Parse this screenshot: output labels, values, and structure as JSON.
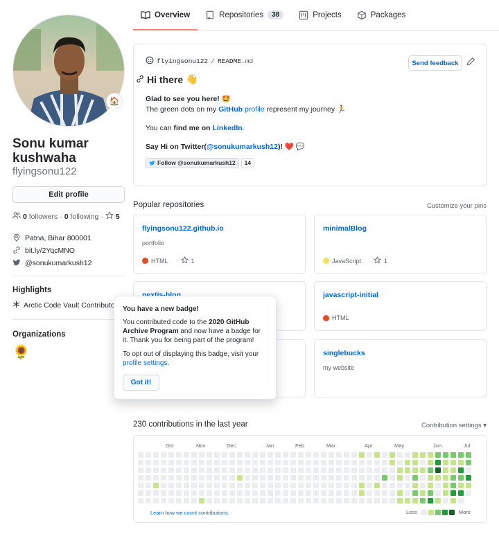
{
  "tabs": [
    {
      "label": "Overview",
      "icon": "book-icon",
      "active": true
    },
    {
      "label": "Repositories",
      "icon": "repo-icon",
      "count": "38"
    },
    {
      "label": "Projects",
      "icon": "project-icon"
    },
    {
      "label": "Packages",
      "icon": "package-icon"
    }
  ],
  "profile": {
    "fullname": "Sonu kumar kushwaha",
    "username": "flyingsonu122",
    "status_emoji": "🏠",
    "edit_label": "Edit profile",
    "followers": "0",
    "followers_label": "followers",
    "following": "0",
    "following_label": "following",
    "stars": "5",
    "location": "Patna, Bihar 800001",
    "website": "bit.ly/2YqcMNO",
    "twitter": "@sonukumarkush12"
  },
  "highlights": {
    "title": "Highlights",
    "item": "Arctic Code Vault Contributor"
  },
  "organizations": {
    "title": "Organizations",
    "icon": "🌻"
  },
  "readme": {
    "owner": "flyingsonu122",
    "separator": "/",
    "file_base": "README",
    "file_ext": ".md",
    "feedback_label": "Send feedback",
    "heading": "Hi there",
    "heading_emoji": "👋",
    "line1": "Glad to see you here! 🤩",
    "line2_a": "The green dots on my ",
    "line2_b": "GitHub",
    "line2_c": " profile",
    "line2_d": " represent my journey 🏃",
    "line3_a": "You can ",
    "line3_b": "find me on",
    "line3_c": " LinkedIn",
    "line3_d": ".",
    "line4_a": "Say Hi on Twitter(",
    "line4_b": "@sonukumarkush12",
    "line4_c": ")! ❤️ 💬",
    "badge_label": "Follow @sonukumarkush12",
    "badge_count": "14"
  },
  "pinned": {
    "title": "Popular repositories",
    "customize": "Customize your pins",
    "repos": [
      {
        "name": "flyingsonu122.github.io",
        "desc": "portfolio",
        "lang": "HTML",
        "lang_color": "#e34c26",
        "stars": "1"
      },
      {
        "name": "minimalBlog",
        "desc": "",
        "lang": "JavaScript",
        "lang_color": "#f1e05a",
        "stars": "1"
      },
      {
        "name": "nextjs-blog",
        "desc": "",
        "lang": "",
        "lang_color": "",
        "stars": ""
      },
      {
        "name": "javascript-initial",
        "desc": "",
        "lang": "HTML",
        "lang_color": "#e34c26",
        "stars": ""
      },
      {
        "name": "",
        "desc": "",
        "lang": "",
        "lang_color": "",
        "stars": ""
      },
      {
        "name": "singlebucks",
        "desc": "my website",
        "lang": "",
        "lang_color": "",
        "stars": ""
      }
    ]
  },
  "popover": {
    "title": "You have a new badge!",
    "text_a": "You contributed code to the ",
    "text_b": "2020 GitHub Archive Program",
    "text_c": " and now have a badge for it. Thank you for being part of the program!",
    "opt_a": "To opt out of displaying this badge, visit your ",
    "opt_b": "profile settings",
    "opt_c": ".",
    "button": "Got it!"
  },
  "contributions": {
    "title": "230 contributions in the last year",
    "settings": "Contribution settings ▾",
    "months": [
      "Oct",
      "Nov",
      "Dec",
      "Jan",
      "Feb",
      "Mar",
      "Apr",
      "May",
      "Jun",
      "Jul"
    ],
    "learn": "Learn how we count contributions.",
    "less": "Less",
    "more": "More",
    "colors": [
      "#ebedf0",
      "#c6e48b",
      "#7bc96f",
      "#239a3b",
      "#196127"
    ]
  }
}
